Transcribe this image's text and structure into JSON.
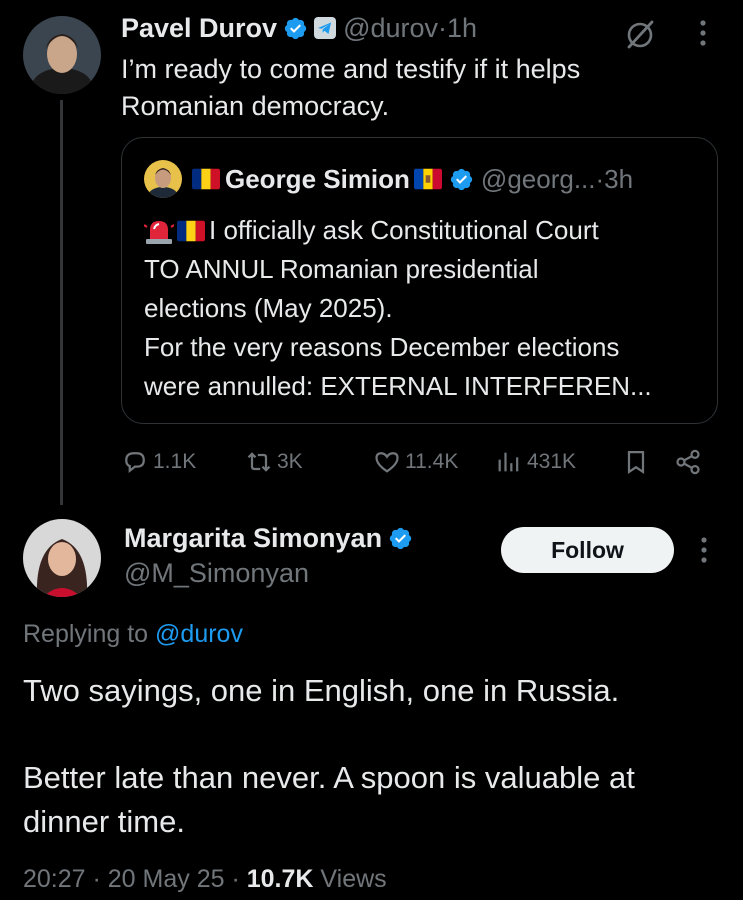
{
  "tweet": {
    "author_name": "Pavel Durov",
    "handle": "@durov",
    "separator": " · ",
    "time_ago": "1h",
    "text_lines": [
      "I’m ready to come and testify if it helps",
      "Romanian democracy."
    ],
    "quote": {
      "author_name": "George Simion",
      "handle": "@georg...",
      "separator": " · ",
      "time_ago": "3h",
      "line1": "I officially ask Constitutional Court",
      "lines": [
        "TO ANNUL Romanian presidential",
        "elections (May 2025).",
        "For the very reasons December elections",
        "were annulled: EXTERNAL INTERFEREN..."
      ]
    },
    "actions": {
      "replies": "1.1K",
      "reposts": "3K",
      "likes": "11.4K",
      "views": "431K"
    }
  },
  "reply": {
    "author_name": "Margarita Simonyan",
    "handle": "@M_Simonyan",
    "follow_label": "Follow",
    "replying_prefix": "Replying to ",
    "replying_to": "@durov",
    "paragraphs": [
      "Two sayings, one in English, one in Russia.",
      "Better late than never. A spoon is valuable at dinner time."
    ],
    "time": "20:27",
    "date": "20 May 25",
    "views_count": "10.7K",
    "views_label": "Views"
  },
  "colors": {
    "background": "#000000",
    "text": "#e7e9ea",
    "muted": "#71767b",
    "accent": "#1d9bf0",
    "verified": "#1d9bf0"
  }
}
